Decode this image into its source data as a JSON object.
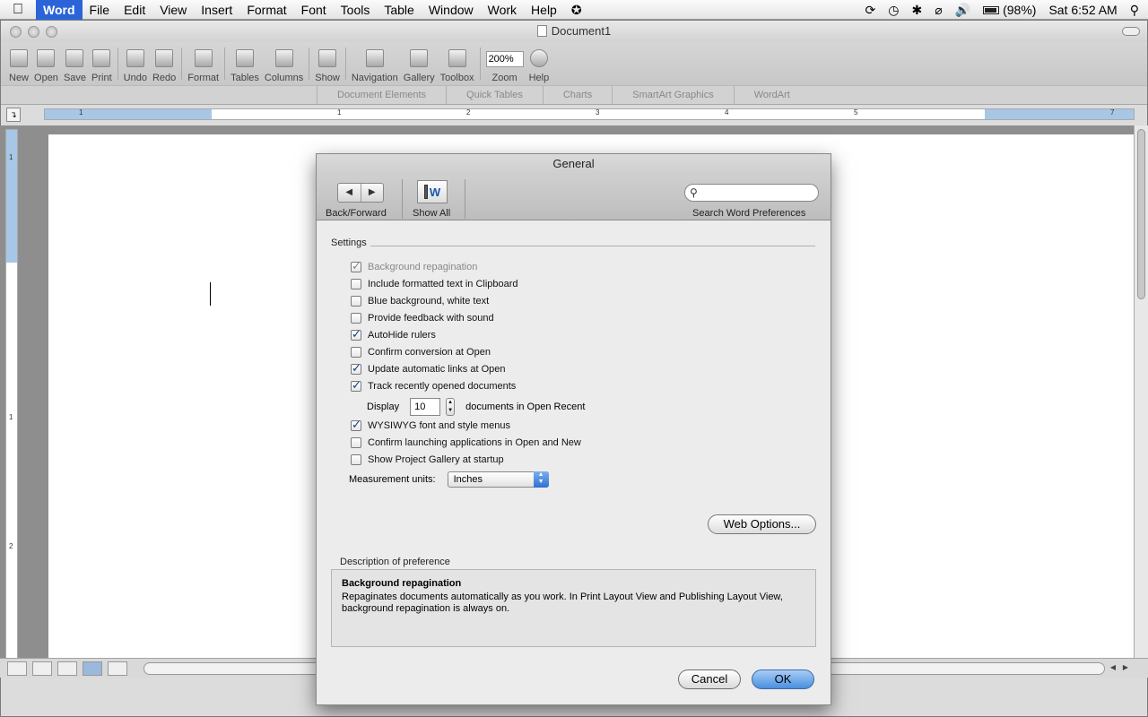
{
  "menubar": {
    "apple": "",
    "items": [
      "Word",
      "File",
      "Edit",
      "View",
      "Insert",
      "Format",
      "Font",
      "Tools",
      "Table",
      "Window",
      "Work",
      "Help"
    ],
    "battery": "(98%)",
    "clock": "Sat 6:52 AM"
  },
  "window": {
    "title": "Document1"
  },
  "toolbar": {
    "buttons": [
      "New",
      "Open",
      "Save",
      "Print",
      "Undo",
      "Redo",
      "Format",
      "Tables",
      "Columns",
      "Show",
      "Navigation",
      "Gallery",
      "Toolbox",
      "Zoom",
      "Help"
    ],
    "zoom_value": "200%"
  },
  "ribbon_tabs": [
    "Document Elements",
    "Quick Tables",
    "Charts",
    "SmartArt Graphics",
    "WordArt"
  ],
  "ruler": {
    "h_numbers": [
      "1",
      "1",
      "2",
      "3",
      "4",
      "5",
      "7"
    ],
    "v_numbers": [
      "1",
      "1",
      "2"
    ]
  },
  "dialog": {
    "title": "General",
    "back_forward_label": "Back/Forward",
    "show_all_label": "Show All",
    "search_label": "Search Word Preferences",
    "search_placeholder": "",
    "settings_heading": "Settings",
    "options": [
      {
        "label": "Background repagination",
        "checked": true,
        "disabled": true
      },
      {
        "label": "Include formatted text in Clipboard",
        "checked": false
      },
      {
        "label": "Blue background, white text",
        "checked": false
      },
      {
        "label": "Provide feedback with sound",
        "checked": false
      },
      {
        "label": "AutoHide rulers",
        "checked": true
      },
      {
        "label": "Confirm conversion at Open",
        "checked": false
      },
      {
        "label": "Update automatic links at Open",
        "checked": true
      },
      {
        "label": "Track recently opened documents",
        "checked": true
      },
      {
        "label": "WYSIWYG font and style menus",
        "checked": true
      },
      {
        "label": "Confirm launching applications in Open and New",
        "checked": false
      },
      {
        "label": "Show Project Gallery at startup",
        "checked": false
      }
    ],
    "display_label": "Display",
    "display_value": "10",
    "display_suffix": "documents in Open Recent",
    "measurement_label": "Measurement units:",
    "measurement_value": "Inches",
    "web_options_label": "Web Options...",
    "description_heading": "Description of preference",
    "description_title": "Background repagination",
    "description_text": "Repaginates documents automatically as you work. In Print Layout View and Publishing Layout View, background repagination is always on.",
    "cancel_label": "Cancel",
    "ok_label": "OK"
  }
}
